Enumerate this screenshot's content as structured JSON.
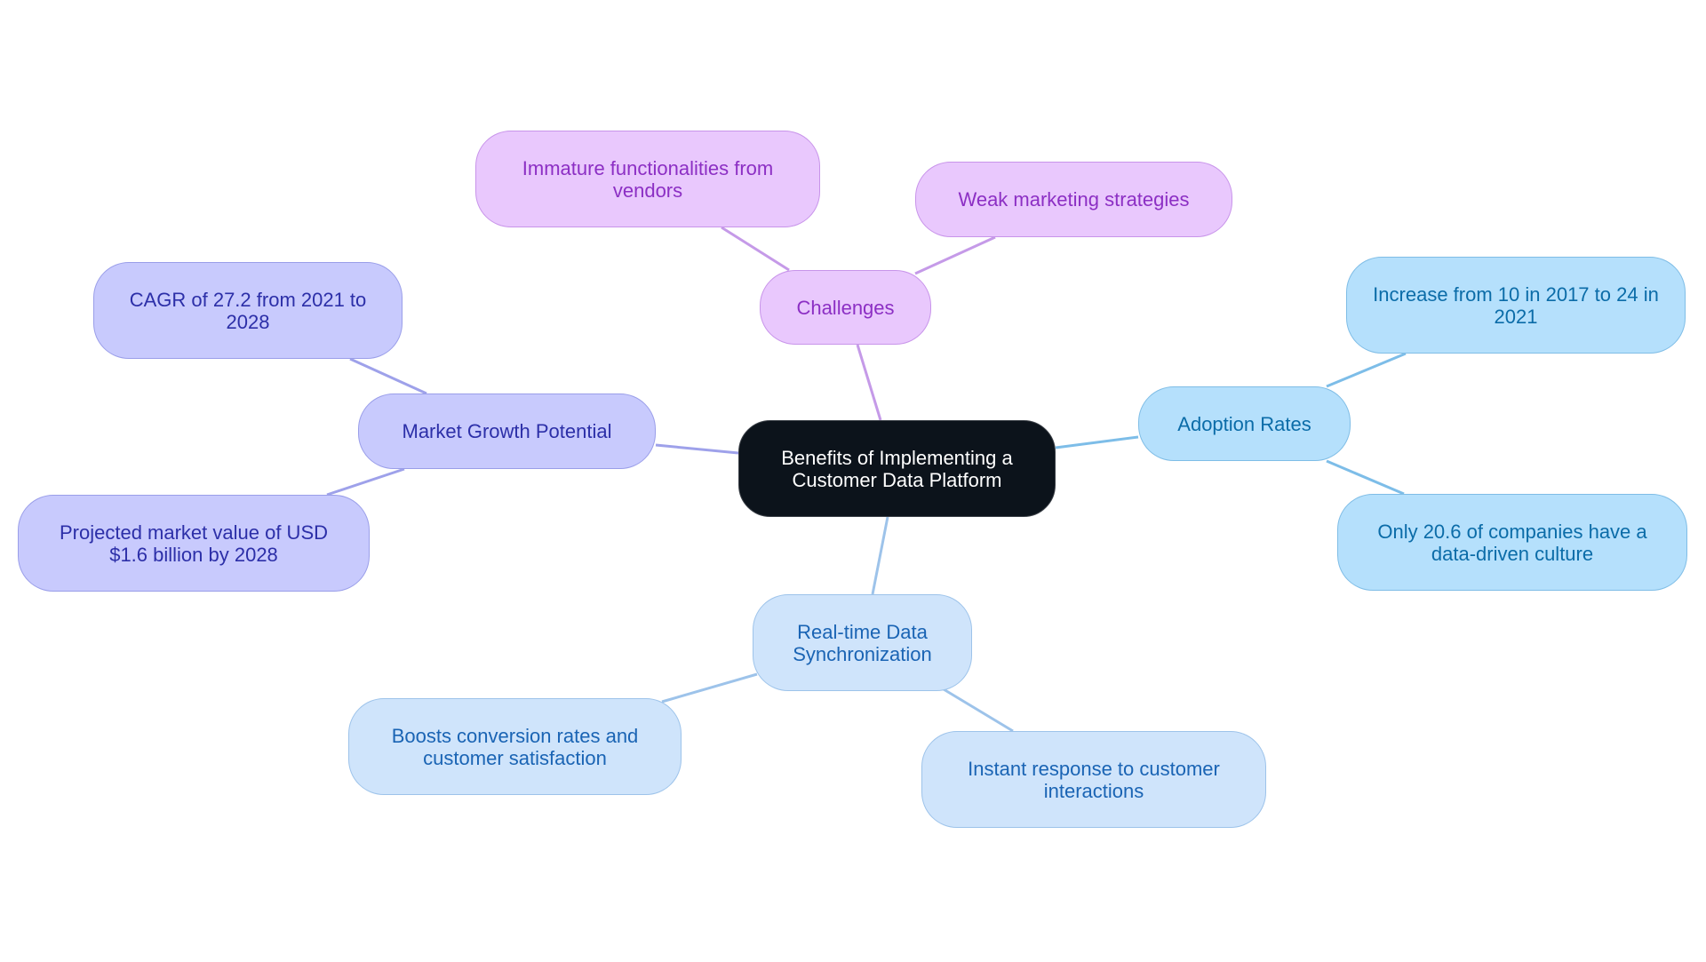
{
  "title": "Benefits of Implementing a Customer Data Platform",
  "colors": {
    "root": "#0c131b",
    "challenges": "#e9c8fd",
    "market_growth": "#c8cafd",
    "adoption": "#b5e0fc",
    "realtime": "#cfe4fb",
    "edge_challenges": "#c59ae8",
    "edge_market": "#9ea1ea",
    "edge_adoption": "#7dbde8",
    "edge_realtime": "#9dc3ea"
  },
  "nodes": {
    "root": {
      "label": "Benefits of Implementing a Customer Data Platform"
    },
    "challenges": {
      "label": "Challenges",
      "children": [
        "Immature functionalities from vendors",
        "Weak marketing strategies"
      ]
    },
    "market_growth": {
      "label": "Market Growth Potential",
      "children": [
        "CAGR of 27.2 from 2021 to 2028",
        "Projected market value of USD $1.6 billion by 2028"
      ]
    },
    "adoption": {
      "label": "Adoption Rates",
      "children": [
        "Increase from 10 in 2017 to 24 in 2021",
        "Only 20.6 of companies have a data-driven culture"
      ]
    },
    "realtime": {
      "label": "Real-time Data Synchronization",
      "children": [
        "Boosts conversion rates and customer satisfaction",
        "Instant response to customer interactions"
      ]
    }
  }
}
